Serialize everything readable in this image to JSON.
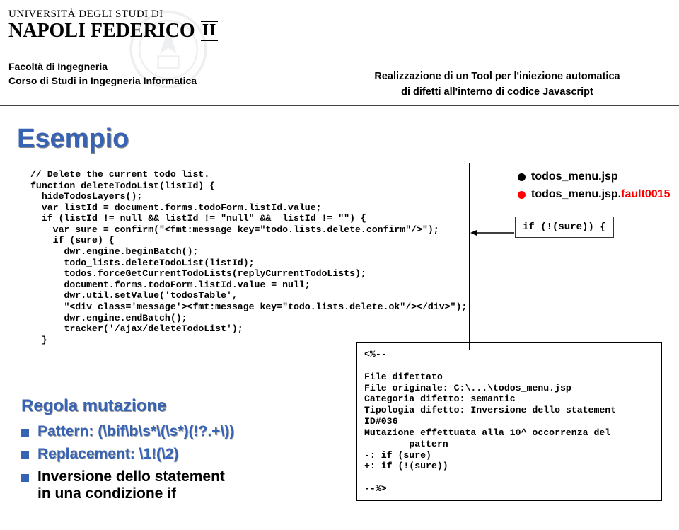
{
  "header": {
    "univ_line1": "UNIVERSITÀ DEGLI STUDI DI",
    "univ_line2": "NAPOLI FEDERICO",
    "roman": "II",
    "faculty": "Facoltà di Ingegneria",
    "course": "Corso di Studi in Ingegneria Informatica",
    "project_line1": "Realizzazione di un Tool per l'iniezione automatica",
    "project_line2": "di difetti all'interno di codice Javascript"
  },
  "title": "Esempio",
  "code": "// Delete the current todo list.\nfunction deleteTodoList(listId) {\n  hideTodosLayers();\n  var listId = document.forms.todoForm.listId.value;\n  if (listId != null && listId != \"null\" &&  listId != \"\") {\n    var sure = confirm(\"<fmt:message key=\"todo.lists.delete.confirm\"/>\");\n    if (sure) {\n      dwr.engine.beginBatch();\n      todo_lists.deleteTodoList(listId);\n      todos.forceGetCurrentTodoLists(replyCurrentTodoLists);\n      document.forms.todoForm.listId.value = null;\n      dwr.util.setValue('todosTable',\n      \"<div class='message'><fmt:message key=\"todo.lists.delete.ok\"/></div>\");\n      dwr.engine.endBatch();\n      tracker('/ajax/deleteTodoList');\n  }",
  "callout_if": "if (!(sure)) {",
  "files": {
    "original": "todos_menu.jsp",
    "fault_prefix": "todos_menu.jsp.",
    "fault_suffix": "fault0015"
  },
  "mutation_comment": "<%--\n\nFile difettato\nFile originale: C:\\...\\todos_menu.jsp\nCategoria difetto: semantic\nTipologia difetto: Inversione dello statement\nID#036\nMutazione effettuata alla 10^ occorrenza del\n        pattern\n-: if (sure)\n+: if (!(sure))\n\n--%>",
  "regola": {
    "heading": "Regola mutazione",
    "pattern_label": "Pattern: ",
    "pattern_value": "(\\bif\\b\\s*\\(\\s*)(!?.+\\))",
    "replacement_label": "Replacement: ",
    "replacement_value": "\\1!(\\2)",
    "inversion_l1": "Inversione dello statement",
    "inversion_l2": "in una condizione if"
  }
}
